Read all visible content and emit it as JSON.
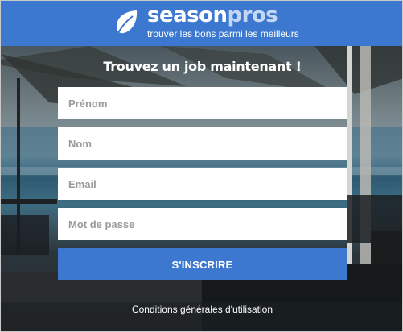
{
  "header": {
    "brand_season": "season",
    "brand_pros": "pros",
    "tagline": "trouver les bons parmi les meilleurs",
    "logo_icon": "leaf-icon"
  },
  "form": {
    "title": "Trouvez un job maintenant !",
    "first_name_placeholder": "Prénom",
    "last_name_placeholder": "Nom",
    "email_placeholder": "Email",
    "password_placeholder": "Mot de passe",
    "submit_label": "S'INSCRIRE"
  },
  "footer": {
    "terms_label": "Conditions générales d'utilisation"
  },
  "colors": {
    "brand_blue": "#3c78d0",
    "brand_light": "#c4d8f6",
    "text_white": "#ffffff"
  }
}
